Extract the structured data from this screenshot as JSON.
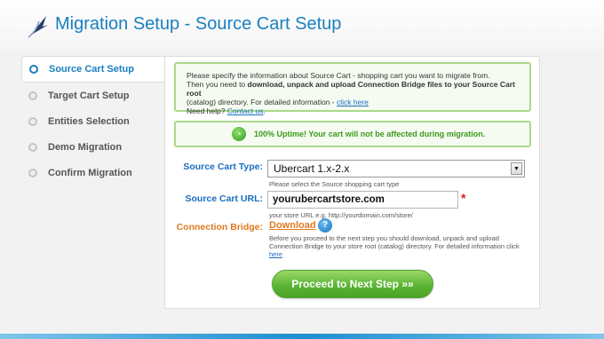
{
  "header": {
    "title": "Migration Setup - Source Cart Setup"
  },
  "sidebar": {
    "items": [
      {
        "label": "Source Cart Setup"
      },
      {
        "label": "Target Cart Setup"
      },
      {
        "label": "Entities Selection"
      },
      {
        "label": "Demo Migration"
      },
      {
        "label": "Confirm Migration"
      }
    ]
  },
  "info": {
    "line1": "Please specify the information about Source Cart - shopping cart you want to migrate from.",
    "line2_prefix": "Then you need to ",
    "line2_bold": "download, unpack and upload Connection Bridge files to your Source Cart root",
    "line3_prefix": "(catalog) directory. For detailed information - ",
    "line3_link": "click here",
    "line4_prefix": "Need help? ",
    "line4_link": "Contact us",
    "line4_suffix": "."
  },
  "uptime": {
    "text": "100% Uptime! Your cart will not be affected during migration."
  },
  "form": {
    "source_cart_type": {
      "label": "Source Cart Type:",
      "value": "Ubercart 1.x-2.x",
      "hint": "Please select the Source shopping cart type"
    },
    "source_cart_url": {
      "label": "Source Cart URL:",
      "value": "yourubercartstore.com",
      "required_mark": "*",
      "hint": "your store URL e.g. http://yourdomain.com/store/"
    },
    "connection_bridge": {
      "label": "Connection Bridge:",
      "download_label": "Download",
      "help_glyph": "?",
      "desc": "Before you proceed to the next step you should download, unpack and upload Connection Bridge to your store root (catalog) directory. For detailed information click ",
      "desc_link": "here"
    },
    "next_button": "Proceed to Next Step »»"
  },
  "icons": {
    "logo": "migration-logo-icon",
    "uptime": "clock-icon",
    "help": "help-icon",
    "dropdown": "dropdown-arrow-icon"
  },
  "colors": {
    "accent": "#1a7fc0",
    "success": "#5cb535",
    "warning": "#e07a1f"
  }
}
